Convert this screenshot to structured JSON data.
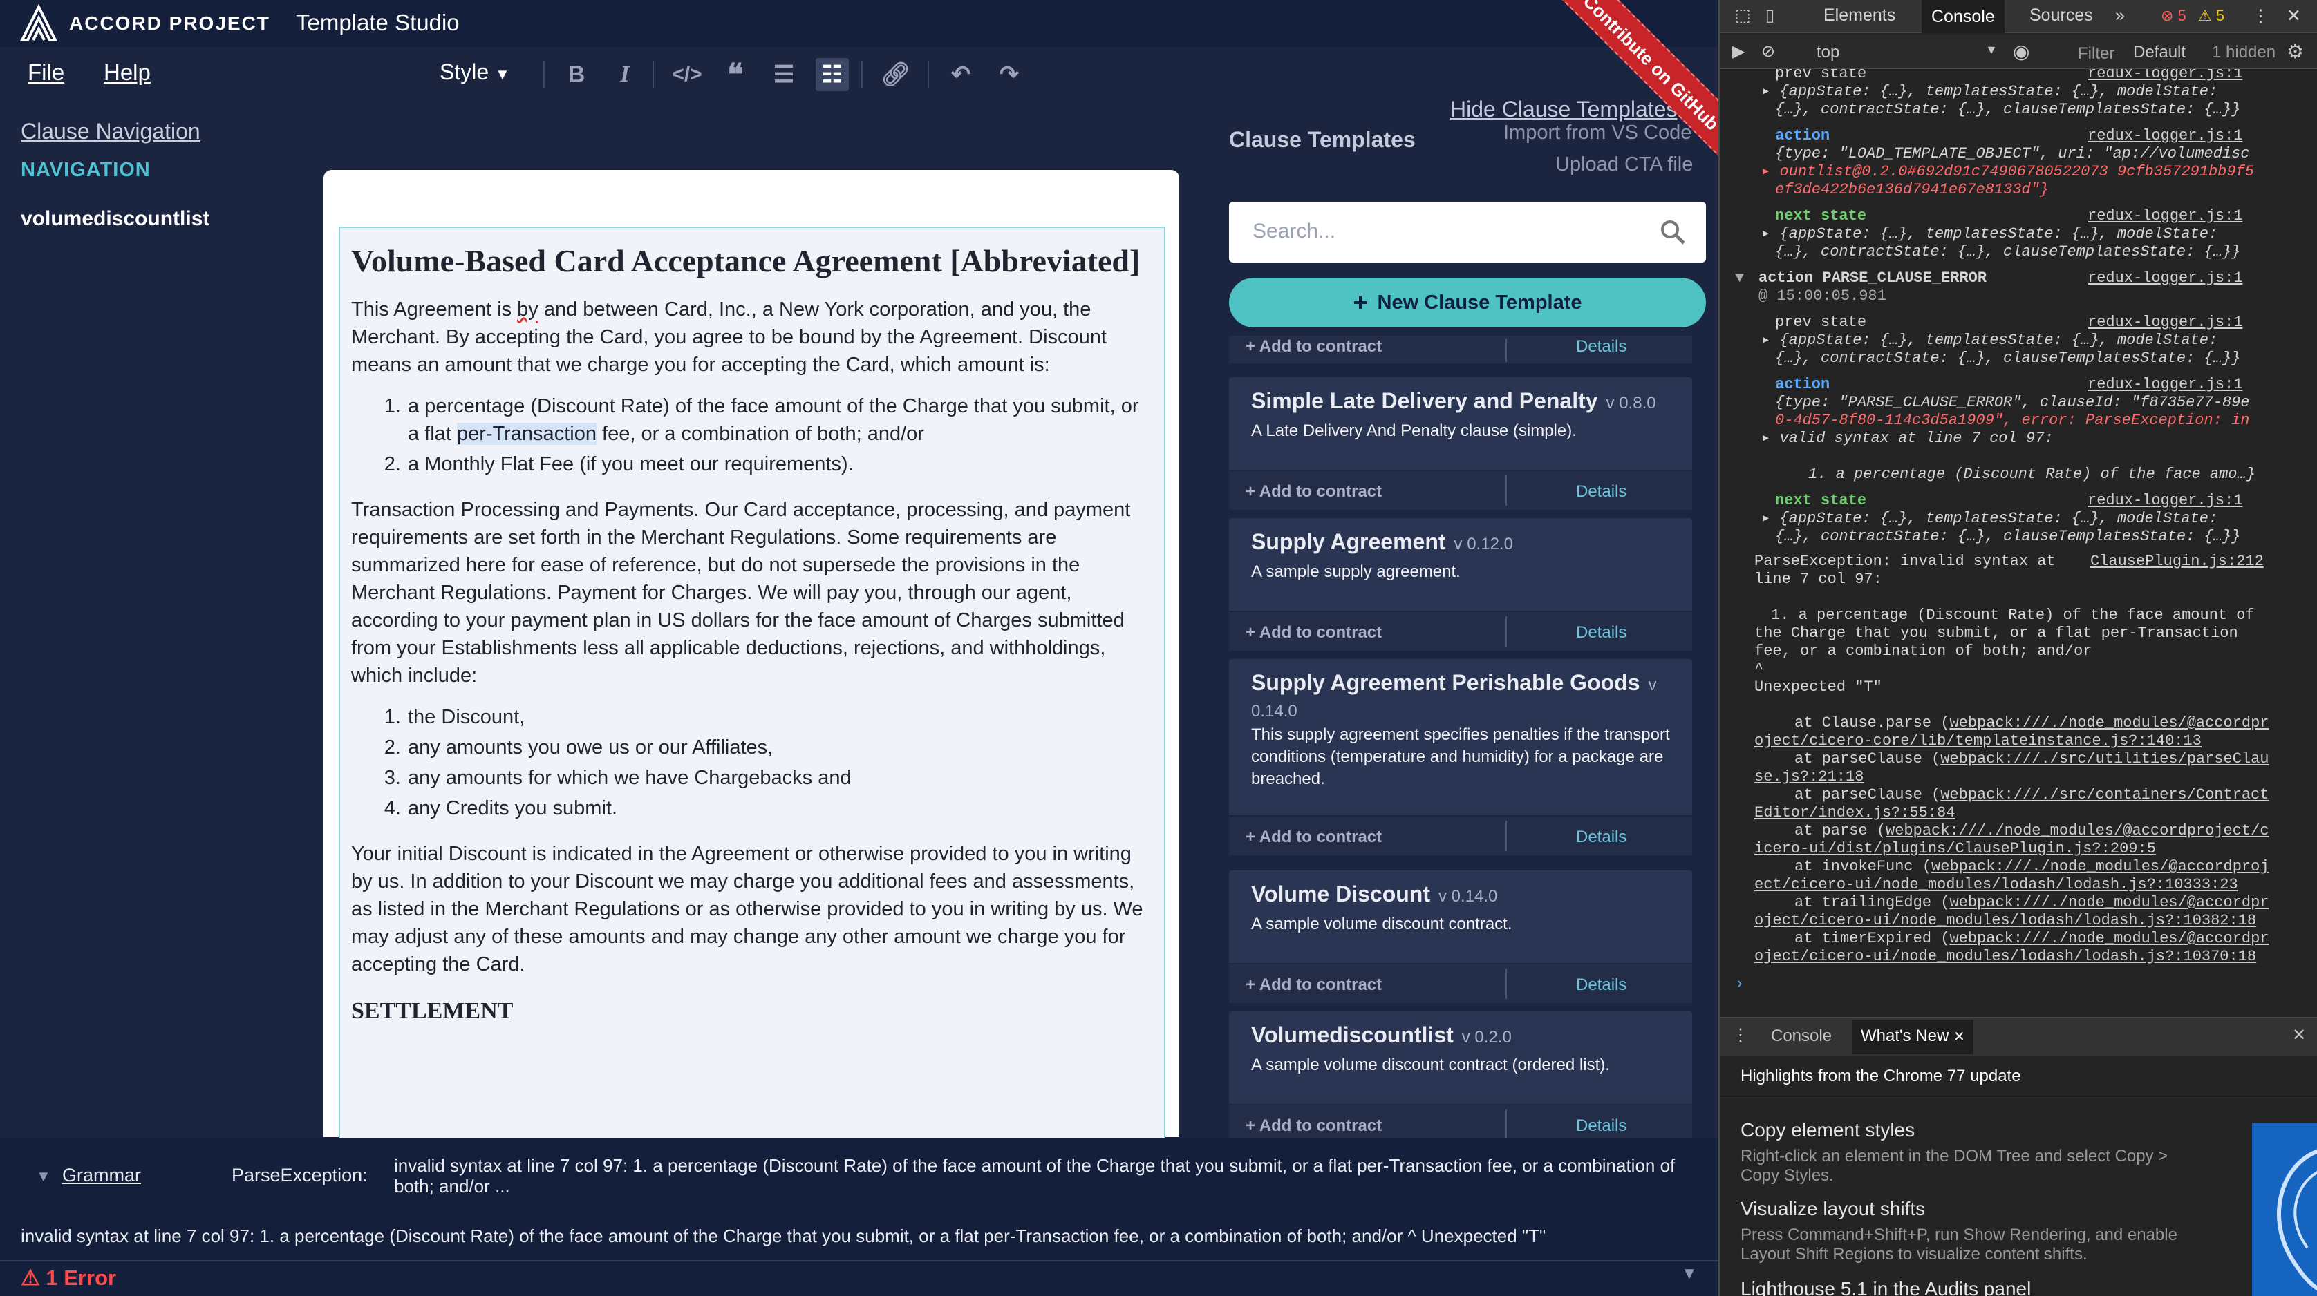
{
  "app": {
    "brand": "ACCORD PROJECT",
    "title": "Template Studio"
  },
  "menu": {
    "file": "File",
    "help": "Help",
    "style": "Style"
  },
  "toolbar": {
    "icons": [
      "bold-icon",
      "italic-icon",
      "code-icon",
      "quote-icon",
      "bullet-list-icon",
      "ordered-list-icon",
      "link-icon",
      "undo-icon",
      "redo-icon"
    ],
    "active": "ordered-list-icon"
  },
  "nav": {
    "link": "Clause Navigation",
    "heading": "NAVIGATION",
    "item": "volumediscountlist"
  },
  "doc": {
    "title": "Volume-Based Card Acceptance Agreement [Abbreviated]",
    "p1a": "This Agreement is ",
    "p1by": "by",
    "p1b": " and between Card, Inc., a New York corporation, and you, the Merchant. By accepting the Card, you agree to be bound by the Agreement. Discount means an amount that we charge you for accepting the Card, which amount is:",
    "list1": {
      "i1a": "a percentage (Discount Rate) of the face amount of the Charge that you submit, or a flat ",
      "i1hl": "per-Transaction",
      "i1b": " fee, or a combination of both; and/or",
      "i2": "a Monthly Flat Fee (if you meet our requirements)."
    },
    "p2": "Transaction Processing and Payments. Our Card acceptance, processing, and payment requirements are set forth in the Merchant Regulations. Some requirements are summarized here for ease of reference, but do not supersede the provisions in the Merchant Regulations. Payment for Charges. We will pay you, through our agent, according to your payment plan in US dollars for the face amount of Charges submitted from your Establishments less all applicable deductions, rejections, and withholdings, which include:",
    "list2": [
      "the Discount,",
      "any amounts you owe us or our Affiliates,",
      "any amounts for which we have Chargebacks and",
      "any Credits you submit."
    ],
    "p3": "Your initial Discount is indicated in the Agreement or otherwise provided to you in writing by us. In addition to your Discount we may charge you additional fees and assessments, as listed in the Merchant Regulations or as otherwise provided to you in writing by us. We may adjust any of these amounts and may change any other amount we charge you for accepting the Card.",
    "h2": "SETTLEMENT"
  },
  "panel": {
    "title": "Clause Templates",
    "hide": "Hide Clause Templates",
    "import": "Import from VS Code",
    "upload": "Upload CTA file",
    "search_placeholder": "Search...",
    "new_button": "New Clause Template",
    "add_label": "Add to contract",
    "details_label": "Details",
    "ribbon": "Contribute on GitHub",
    "cards": [
      {
        "name": "Simple Late Delivery and Penalty",
        "version": "v 0.8.0",
        "desc": "A Late Delivery And Penalty clause (simple)."
      },
      {
        "name": "Supply Agreement",
        "version": "v 0.12.0",
        "desc": "A sample supply agreement."
      },
      {
        "name": "Supply Agreement Perishable Goods",
        "version": "v",
        "version2": "0.14.0",
        "desc": "This supply agreement specifies penalties if the transport conditions (temperature and humidity) for a package are breached."
      },
      {
        "name": "Volume Discount",
        "version": "v 0.14.0",
        "desc": "A sample volume discount contract."
      },
      {
        "name": "Volumediscountlist",
        "version": "v 0.2.0",
        "desc": "A sample volume discount contract (ordered list)."
      }
    ]
  },
  "errors": {
    "section": "Grammar",
    "type": "ParseException:",
    "message": "invalid syntax at line 7 col 97: 1. a percentage (Discount Rate) of the face amount of the Charge that you submit, or a flat per-Transaction fee, or a combination of both; and/or ...",
    "full": "invalid syntax at line 7 col 97: 1. a percentage (Discount Rate) of the face amount of the Charge that you submit, or a flat per-Transaction fee, or a combination of both; and/or ^ Unexpected \"T\"",
    "count": "1 Error"
  },
  "devtools": {
    "tabs": [
      "Elements",
      "Console",
      "Sources"
    ],
    "active_tab": "Console",
    "errors_count": "5",
    "warnings_count": "5",
    "context": "top",
    "filter": "Filter",
    "levels": "Default",
    "hidden": "1 hidden",
    "lines": {
      "prev": "prev state",
      "logger": "redux-logger.js:1",
      "state_obj": "{appState: {…}, templatesState: {…}, modelState:",
      "state_obj2": "{…}, contractState: {…}, clauseTemplatesState: {…}}",
      "action": "action",
      "next": "next state",
      "a1": "{type: \"LOAD_TEMPLATE_OBJECT\", uri: \"ap://volumedisc",
      "a1b": "ountlist@0.2.0#692d91c74906780522073 9cfb357291bb9f5",
      "a1c": "ef3de422b6e136d7941e67e8133d\"}",
      "group": "action PARSE_CLAUSE_ERROR",
      "time": "@ 15:00:05.981",
      "a2": "{type: \"PARSE_CLAUSE_ERROR\", clauseId: \"f8735e77-89e",
      "a2b": "0-4d57-8f80-114c3d5a1909\", error: ParseException: in",
      "a2c": "valid syntax at line 7 col 97:",
      "a2d": "1. a percentage (Discount Rate) of the face amo…}",
      "pe1": "ParseException: invalid syntax at",
      "pe_src": "ClausePlugin.js:212",
      "pe2": "line 7 col 97:",
      "pe3": "1. a percentage (Discount Rate) of the face amount of",
      "pe4": "the Charge that you submit, or a flat per-Transaction",
      "pe5": "fee, or a combination of both; and/or",
      "pe6": "^",
      "pe7": "Unexpected \"T\"",
      "s1": "at Clause.parse (",
      "s1l": "webpack:///./node_modules/@accordpr",
      "s1l2": "oject/cicero-core/lib/templateinstance.js?:140:13",
      "s2": "at parseClause (",
      "s2l": "webpack:///./src/utilities/parseClau",
      "s2l2": "se.js?:21:18",
      "s3": "at parseClause (",
      "s3l": "webpack:///./src/containers/Contract",
      "s3l2": "Editor/index.js?:55:84",
      "s4": "at parse (",
      "s4l": "webpack:///./node_modules/@accordproject/c",
      "s4l2": "icero-ui/dist/plugins/ClausePlugin.js?:209:5",
      "s5": "at invokeFunc (",
      "s5l": "webpack:///./node_modules/@accordproj",
      "s5l2": "ect/cicero-ui/node_modules/lodash/lodash.js?:10333:23",
      "s6": "at trailingEdge (",
      "s6l": "webpack:///./node_modules/@accordpr",
      "s6l2": "oject/cicero-ui/node_modules/lodash/lodash.js?:10382:18",
      "s7": "at timerExpired (",
      "s7l": "webpack:///./node_modules/@accordpr",
      "s7l2": "oject/cicero-ui/node_modules/lodash/lodash.js?:10370:18"
    },
    "drawer": {
      "tab1": "Console",
      "tab2": "What's New",
      "headline": "Highlights from the Chrome 77 update",
      "items": [
        {
          "title": "Copy element styles",
          "desc": "Right-click an element in the DOM Tree and select Copy > Copy Styles."
        },
        {
          "title": "Visualize layout shifts",
          "desc": "Press Command+Shift+P, run Show Rendering, and enable Layout Shift Regions to visualize content shifts."
        },
        {
          "title": "Lighthouse 5.1 in the Audits panel",
          "desc": ""
        }
      ]
    }
  }
}
